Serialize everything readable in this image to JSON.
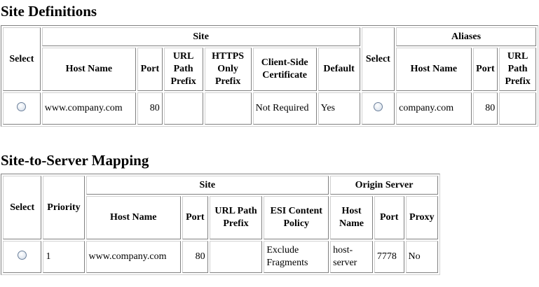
{
  "site_definitions": {
    "title": "Site Definitions",
    "header": {
      "select": "Select",
      "site_group": "Site",
      "aliases_group": "Aliases",
      "host_name": "Host Name",
      "port": "Port",
      "url_path_prefix": "URL Path Prefix",
      "https_only_prefix": "HTTPS Only Prefix",
      "client_side_certificate": "Client-Side Certificate",
      "default": "Default",
      "alias_select": "Select",
      "alias_host_name": "Host Name",
      "alias_port": "Port",
      "alias_url_path_prefix": "URL Path Prefix"
    },
    "rows": [
      {
        "host_name": "www.company.com",
        "port": "80",
        "url_path_prefix": "",
        "https_only_prefix": "",
        "client_side_certificate": "Not Required",
        "default": "Yes",
        "alias_host_name": "company.com",
        "alias_port": "80",
        "alias_url_path_prefix": ""
      }
    ]
  },
  "site_to_server_mapping": {
    "title": "Site-to-Server Mapping",
    "header": {
      "select": "Select",
      "priority": "Priority",
      "site_group": "Site",
      "origin_group": "Origin Server",
      "host_name": "Host Name",
      "port": "Port",
      "url_path_prefix": "URL Path Prefix",
      "esi_content_policy": "ESI Content Policy",
      "origin_host_name": "Host Name",
      "origin_port": "Port",
      "proxy": "Proxy"
    },
    "rows": [
      {
        "priority": "1",
        "host_name": "www.company.com",
        "port": "80",
        "url_path_prefix": "",
        "esi_content_policy": "Exclude Fragments",
        "origin_host_name": "host-server",
        "origin_port": "7778",
        "proxy": "No"
      }
    ]
  }
}
